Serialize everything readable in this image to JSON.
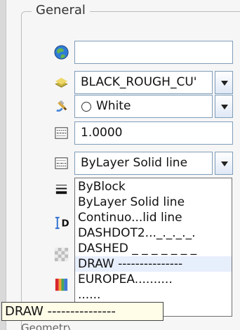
{
  "panel": {
    "section_title": "General"
  },
  "properties": [
    {
      "key": "color-swatch",
      "value": "",
      "icon": "globe-icon"
    },
    {
      "key": "layer",
      "value": "BLACK_ROUGH_CU'",
      "icon": "layer-icon"
    },
    {
      "key": "color",
      "value": "White",
      "icon": "paint-icon"
    },
    {
      "key": "scale",
      "value": "1.0000",
      "icon": "linetype-scale-icon"
    },
    {
      "key": "linetype",
      "value": "ByLayer    Solid line",
      "icon": "linetype-icon"
    }
  ],
  "dropdown": {
    "options": [
      "ByBlock",
      "ByLayer    Solid line",
      "Continuo...lid line",
      "DASHDOT2..._._._._.",
      "DASHED  _ _ _ _ _ _ _",
      "DRAW ---------------",
      "EUROPEA..........",
      "......"
    ],
    "highlighted_index": 5
  },
  "tooltip": {
    "text": "DRAW ---------------"
  },
  "bottom_partial": {
    "text": "Geometry"
  },
  "icons": {
    "lineweight": "lineweight-icon",
    "dimension": "dimension-icon",
    "transparency": "transparency-icon",
    "material": "material-icon"
  }
}
